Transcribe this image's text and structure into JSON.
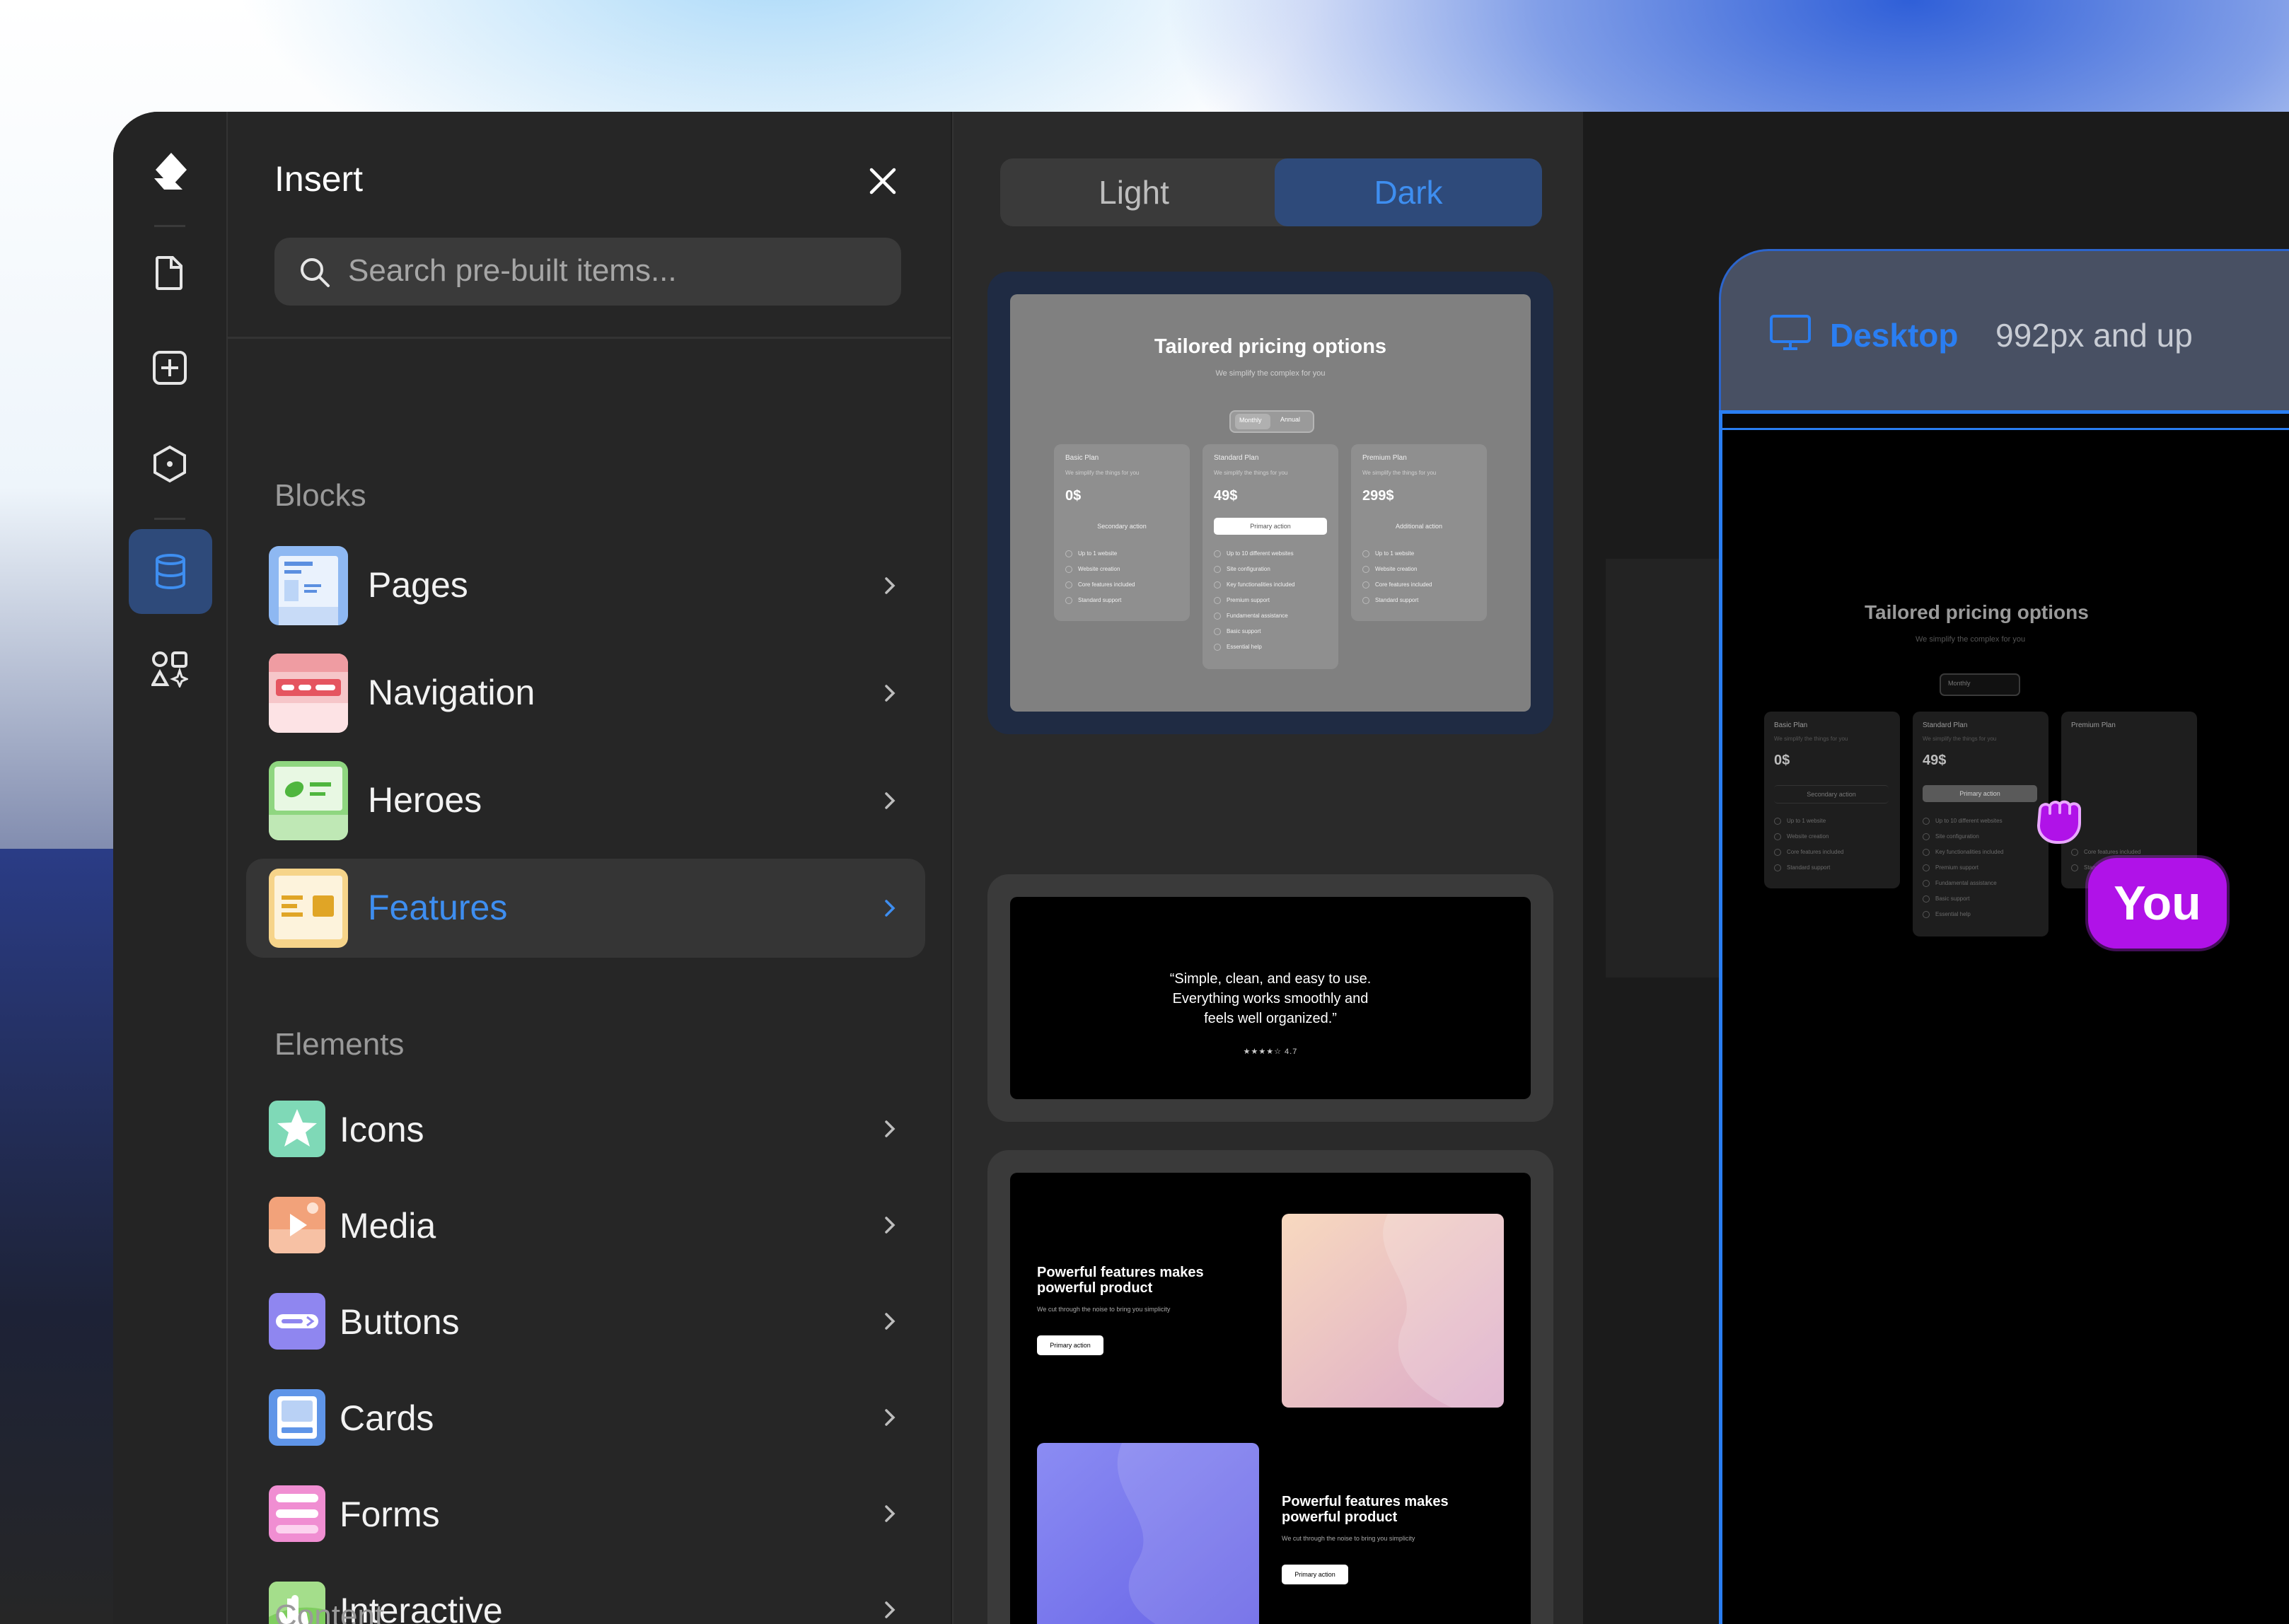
{
  "insert_panel": {
    "title": "Insert",
    "search_placeholder": "Search pre-built items...",
    "blocks_heading": "Blocks",
    "blocks": [
      {
        "label": "Pages",
        "icon": "pages-icon",
        "selected": false
      },
      {
        "label": "Navigation",
        "icon": "navigation-icon",
        "selected": false
      },
      {
        "label": "Heroes",
        "icon": "heroes-icon",
        "selected": false
      },
      {
        "label": "Features",
        "icon": "features-icon",
        "selected": true
      }
    ],
    "elements_heading": "Elements",
    "elements": [
      {
        "label": "Icons",
        "icon": "star-icon"
      },
      {
        "label": "Media",
        "icon": "media-icon"
      },
      {
        "label": "Buttons",
        "icon": "button-icon"
      },
      {
        "label": "Cards",
        "icon": "card-icon"
      },
      {
        "label": "Forms",
        "icon": "form-icon"
      },
      {
        "label": "Interactive",
        "icon": "pointer-icon"
      }
    ],
    "content_heading": "Content"
  },
  "theme_toggle": {
    "light": "Light",
    "dark": "Dark",
    "selected": "Dark"
  },
  "pricing_preview": {
    "title": "Tailored pricing options",
    "subtitle": "We simplify the complex for you",
    "toggle": [
      "Monthly",
      "Annual"
    ],
    "plans": [
      {
        "name": "Basic Plan",
        "desc": "We simplify the things for you",
        "price": "0$",
        "button": "Secondary action",
        "features": [
          "Up to 1 website",
          "Website creation",
          "Core features included",
          "Standard support"
        ]
      },
      {
        "name": "Standard Plan",
        "desc": "We simplify the things for you",
        "price": "49$",
        "button": "Primary action",
        "features": [
          "Up to 10 different websites",
          "Site configuration",
          "Key functionalities included",
          "Premium support",
          "Fundamental assistance",
          "Basic support",
          "Essential help"
        ]
      },
      {
        "name": "Premium Plan",
        "desc": "We simplify the things for you",
        "price": "299$",
        "button": "Additional action",
        "features": [
          "Up to 1 website",
          "Website creation",
          "Core features included",
          "Standard support"
        ]
      }
    ]
  },
  "testimonial_preview": {
    "line1": "“Simple, clean, and easy to use.",
    "line2": "Everything works smoothly and",
    "line3": "feels well organized.”",
    "rating": "★★★★☆ 4.7"
  },
  "features_preview": {
    "heading_line1": "Powerful features makes",
    "heading_line2": "powerful product",
    "subtext": "We cut through the noise to bring you simplicity",
    "button": "Primary action"
  },
  "canvas": {
    "breakpoint_label": "Desktop",
    "breakpoint_range": "992px and up",
    "dragged_title": "Tailored pricing options",
    "dragged_subtitle": "We simplify the complex for you",
    "dragged_toggle": "Monthly",
    "cursor_label": "You"
  },
  "colors": {
    "accent_blue": "#3e8ef0",
    "selection_blue": "#2a7ef2",
    "cursor_purple": "#b012e8",
    "panel_bg": "#262626"
  }
}
